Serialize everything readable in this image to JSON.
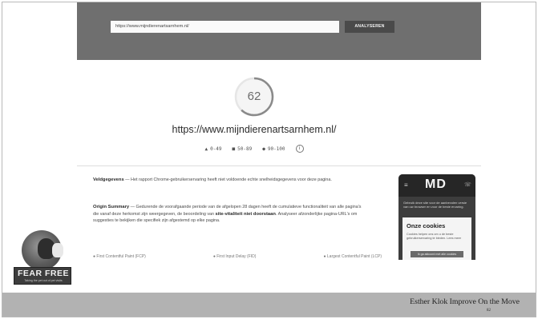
{
  "pagespeed": {
    "url_input_value": "https://www.mijndierenartsarnhem.nl/",
    "analyse_button_label": "ANALYSEREN",
    "score": 62,
    "site_url": "https://www.mijndierenartsarnhem.nl/",
    "legend": [
      {
        "icon": "triangle-icon",
        "symbol": "▲",
        "label": "0-49"
      },
      {
        "icon": "square-icon",
        "symbol": "■",
        "label": "50-89"
      },
      {
        "icon": "circle-icon",
        "symbol": "●",
        "label": "90-100"
      }
    ],
    "info_icon_symbol": "i",
    "field_data": {
      "heading": "Veldgegevens",
      "text": " — Het rapport Chrome-gebruikerservaring heeft niet voldoende echte snelheidsgegevens voor deze pagina."
    },
    "origin_summary": {
      "heading": "Origin Summary",
      "text": " — Gedurende de voorafgaande periode van de afgelopen 28 dagen heeft de cumulatieve functionaliteit van alle pagina's die vanaf deze herkomst zijn weergegeven, de beoordeling van ",
      "bold_text": "site-vitaliteit niet doorstaan",
      "text_after": ". Analyseer afzonderlijke pagina-URL's om suggesties te bekijken die specifiek zijn afgestemd op elke pagina."
    },
    "metrics_row": [
      "● First Contentful Paint (FCP)",
      "● First Input Delay (FID)",
      "● Largest Contentful Paint (LCP)"
    ],
    "phone_preview": {
      "menu_symbol": "≡",
      "logo": "MD",
      "call_symbol": "☏",
      "notice": "Gebruik deze site voor de aanbevolen versie van uw browser en voor de beste ervaring.",
      "cookie_title": "Onze cookies",
      "cookie_text": "Cookies helpen ons om u de beste gebruikerservaring te bieden. Lees meer",
      "cookie_button": "Ik ga akkoord met alle cookies"
    }
  },
  "logo": {
    "brand": "FEAR FREE",
    "tagline": "Taking the pet out of pet visits"
  },
  "footer": {
    "author": "Esther Klok   Improve On the Move",
    "page_number": "82"
  },
  "colors": {
    "header_bg": "#6f6f6f",
    "footer_bg": "#b2b2b2",
    "gauge_arc": "#8a8a8a"
  }
}
